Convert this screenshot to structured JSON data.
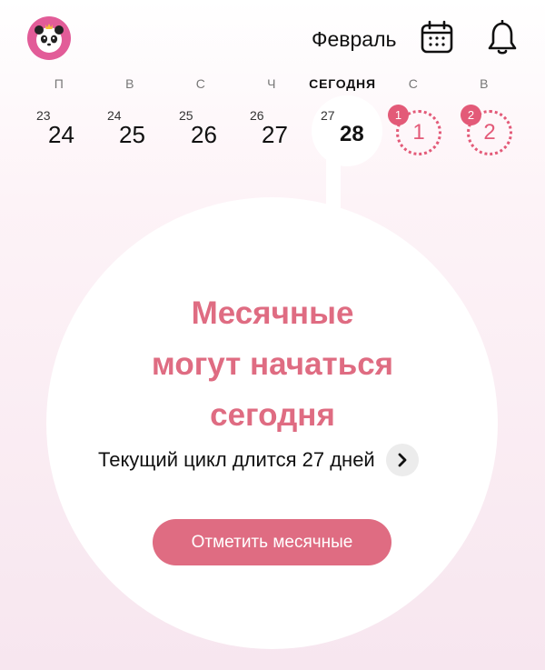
{
  "header": {
    "month": "Февраль"
  },
  "week": {
    "days": [
      {
        "weekday": "П",
        "prev_num": "23",
        "num": "24"
      },
      {
        "weekday": "В",
        "prev_num": "24",
        "num": "25"
      },
      {
        "weekday": "С",
        "prev_num": "25",
        "num": "26"
      },
      {
        "weekday": "Ч",
        "prev_num": "26",
        "num": "27"
      },
      {
        "weekday": "СЕГОДНЯ",
        "prev_num": "27",
        "num": "28"
      },
      {
        "weekday": "С",
        "badge": "1",
        "num": "1"
      },
      {
        "weekday": "В",
        "badge": "2",
        "num": "2"
      }
    ]
  },
  "main": {
    "headline_line1": "Месячные",
    "headline_line2": "могут начаться",
    "headline_line3": "сегодня",
    "cycle_text": "Текущий цикл длится 27 дней",
    "mark_button": "Отметить месячные"
  },
  "colors": {
    "accent": "#df6c82",
    "prediction": "#e35a78",
    "avatar_bg": "#e25c98"
  },
  "icons": {
    "avatar": "panda-avatar-icon",
    "calendar": "calendar-icon",
    "bell": "bell-icon",
    "arrow": "chevron-right-icon"
  }
}
